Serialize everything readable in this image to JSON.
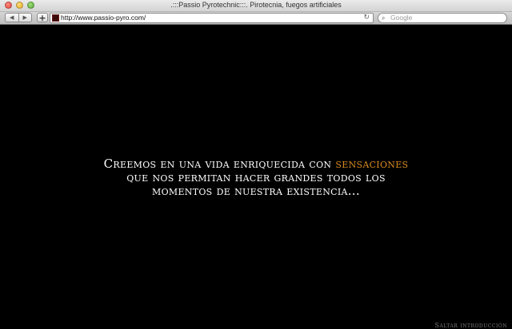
{
  "window": {
    "title": ".:::Passio Pyrotechnic:::. Pirotecnia, fuegos artificiales"
  },
  "toolbar": {
    "back_icon": "back-arrow-icon",
    "forward_icon": "forward-arrow-icon",
    "add_bookmark_label": "+",
    "url": "http://www.passio-pyro.com/",
    "reload_icon": "reload-icon",
    "search_placeholder": "Google"
  },
  "intro": {
    "line1_prefix": "Creemos en una vida enriquecida con",
    "line1_highlight": "sensaciones",
    "line2": "que nos permitan hacer grandes todos los",
    "line3": "momentos de nuestra existencia..."
  },
  "skip_link": "Saltar introducción",
  "colors": {
    "background": "#000000",
    "text": "#ffffff",
    "highlight": "#d98a1e"
  }
}
